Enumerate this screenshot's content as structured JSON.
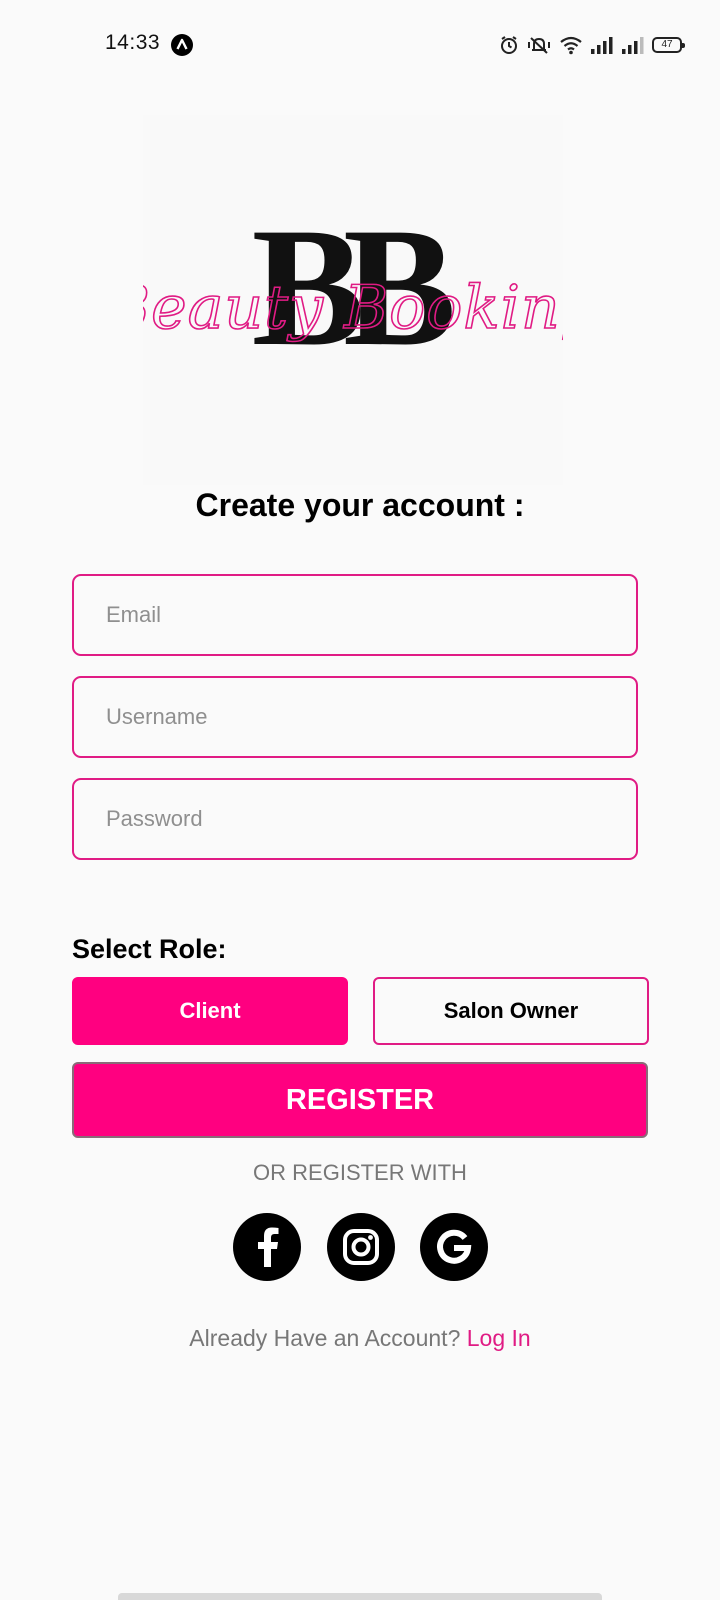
{
  "status_bar": {
    "time": "14:33",
    "battery": "47",
    "icons": [
      "app-icon",
      "alarm-icon",
      "mute-icon",
      "wifi-icon",
      "signal-icon",
      "signal-icon",
      "battery-icon"
    ]
  },
  "logo": {
    "initials": "BB",
    "script_text": "Beauty Booking",
    "brand_color": "#e01b84"
  },
  "form": {
    "title": "Create your account :",
    "email_placeholder": "Email",
    "username_placeholder": "Username",
    "password_placeholder": "Password"
  },
  "role": {
    "label": "Select Role:",
    "options": [
      "Client",
      "Salon Owner"
    ],
    "selected": "Client"
  },
  "register": {
    "label": "REGISTER",
    "or_text": "OR REGISTER WITH",
    "social": [
      "facebook-icon",
      "instagram-icon",
      "google-icon"
    ]
  },
  "footer": {
    "prompt": "Already Have an Account?",
    "link": "Log In"
  },
  "colors": {
    "accent": "#ff0080",
    "border": "#e01b84",
    "background": "#fafafa"
  }
}
